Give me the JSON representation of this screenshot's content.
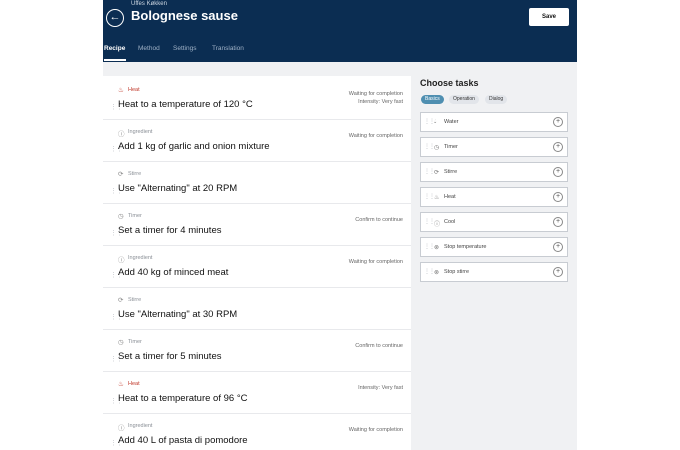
{
  "header": {
    "subtitle": "Uffes Køkken",
    "title": "Bolognese sause",
    "save_label": "Save",
    "back_icon": "back-arrow-icon"
  },
  "tabs": [
    {
      "label": "Recipe",
      "active": true
    },
    {
      "label": "Method",
      "active": false
    },
    {
      "label": "Settings",
      "active": false
    },
    {
      "label": "Translation",
      "active": false
    }
  ],
  "steps": [
    {
      "type": "Heat",
      "icon": "flame-icon",
      "desc": "Heat to a temperature of 120 °C",
      "status1": "Waiting for completion",
      "status2": "Intensity: Very fast"
    },
    {
      "type": "Ingredient",
      "icon": "ingredient-icon",
      "desc": "Add 1 kg of garlic and onion mixture",
      "status1": "Waiting for completion",
      "status2": ""
    },
    {
      "type": "Stirre",
      "icon": "stir-icon",
      "desc": "Use \"Alternating\" at 20 RPM",
      "status1": "",
      "status2": ""
    },
    {
      "type": "Timer",
      "icon": "timer-icon",
      "desc": "Set a timer for 4 minutes",
      "status1": "Confirm to continue",
      "status2": ""
    },
    {
      "type": "Ingredient",
      "icon": "ingredient-icon",
      "desc": "Add 40 kg of minced meat",
      "status1": "Waiting for completion",
      "status2": ""
    },
    {
      "type": "Stirre",
      "icon": "stir-icon",
      "desc": "Use \"Alternating\" at 30 RPM",
      "status1": "",
      "status2": ""
    },
    {
      "type": "Timer",
      "icon": "timer-icon",
      "desc": "Set a timer for 5 minutes",
      "status1": "Confirm to continue",
      "status2": ""
    },
    {
      "type": "Heat",
      "icon": "flame-icon",
      "desc": "Heat to a temperature of 96 °C",
      "status1": "Intensity: Very fast",
      "status2": ""
    },
    {
      "type": "Ingredient",
      "icon": "ingredient-icon",
      "desc": "Add 40 L of pasta di pomodore",
      "status1": "Waiting for completion",
      "status2": ""
    }
  ],
  "tasks_panel": {
    "title": "Choose tasks",
    "chips": [
      {
        "label": "Basics",
        "active": true
      },
      {
        "label": "Operation",
        "active": false
      },
      {
        "label": "Dialog",
        "active": false
      }
    ],
    "tasks": [
      {
        "label": "Water",
        "icon": "water-drop-icon"
      },
      {
        "label": "Timer",
        "icon": "timer-icon"
      },
      {
        "label": "Stirre",
        "icon": "stir-icon"
      },
      {
        "label": "Heat",
        "icon": "flame-icon"
      },
      {
        "label": "Cool",
        "icon": "cool-icon"
      },
      {
        "label": "Stop temperature",
        "icon": "stop-icon"
      },
      {
        "label": "Stop stirre",
        "icon": "stop-icon"
      }
    ]
  },
  "colors": {
    "header_bg": "#0b2d52",
    "heat_accent": "#c0392b",
    "chip_active": "#4f8fb1"
  }
}
